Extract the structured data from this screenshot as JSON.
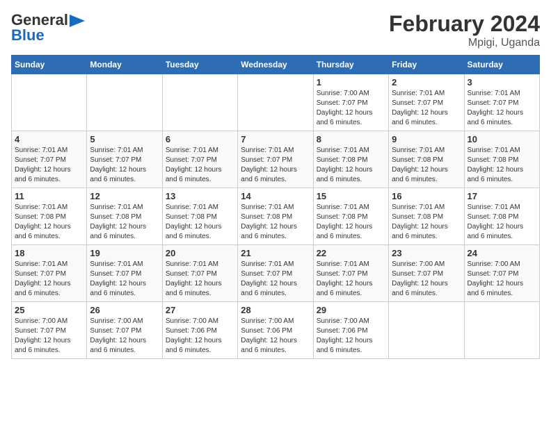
{
  "header": {
    "logo_general": "General",
    "logo_blue": "Blue",
    "main_title": "February 2024",
    "subtitle": "Mpigi, Uganda"
  },
  "days_of_week": [
    "Sunday",
    "Monday",
    "Tuesday",
    "Wednesday",
    "Thursday",
    "Friday",
    "Saturday"
  ],
  "weeks": [
    [
      {
        "day": "",
        "info": ""
      },
      {
        "day": "",
        "info": ""
      },
      {
        "day": "",
        "info": ""
      },
      {
        "day": "",
        "info": ""
      },
      {
        "day": "1",
        "info": "Sunrise: 7:00 AM\nSunset: 7:07 PM\nDaylight: 12 hours\nand 6 minutes."
      },
      {
        "day": "2",
        "info": "Sunrise: 7:01 AM\nSunset: 7:07 PM\nDaylight: 12 hours\nand 6 minutes."
      },
      {
        "day": "3",
        "info": "Sunrise: 7:01 AM\nSunset: 7:07 PM\nDaylight: 12 hours\nand 6 minutes."
      }
    ],
    [
      {
        "day": "4",
        "info": "Sunrise: 7:01 AM\nSunset: 7:07 PM\nDaylight: 12 hours\nand 6 minutes."
      },
      {
        "day": "5",
        "info": "Sunrise: 7:01 AM\nSunset: 7:07 PM\nDaylight: 12 hours\nand 6 minutes."
      },
      {
        "day": "6",
        "info": "Sunrise: 7:01 AM\nSunset: 7:07 PM\nDaylight: 12 hours\nand 6 minutes."
      },
      {
        "day": "7",
        "info": "Sunrise: 7:01 AM\nSunset: 7:07 PM\nDaylight: 12 hours\nand 6 minutes."
      },
      {
        "day": "8",
        "info": "Sunrise: 7:01 AM\nSunset: 7:08 PM\nDaylight: 12 hours\nand 6 minutes."
      },
      {
        "day": "9",
        "info": "Sunrise: 7:01 AM\nSunset: 7:08 PM\nDaylight: 12 hours\nand 6 minutes."
      },
      {
        "day": "10",
        "info": "Sunrise: 7:01 AM\nSunset: 7:08 PM\nDaylight: 12 hours\nand 6 minutes."
      }
    ],
    [
      {
        "day": "11",
        "info": "Sunrise: 7:01 AM\nSunset: 7:08 PM\nDaylight: 12 hours\nand 6 minutes."
      },
      {
        "day": "12",
        "info": "Sunrise: 7:01 AM\nSunset: 7:08 PM\nDaylight: 12 hours\nand 6 minutes."
      },
      {
        "day": "13",
        "info": "Sunrise: 7:01 AM\nSunset: 7:08 PM\nDaylight: 12 hours\nand 6 minutes."
      },
      {
        "day": "14",
        "info": "Sunrise: 7:01 AM\nSunset: 7:08 PM\nDaylight: 12 hours\nand 6 minutes."
      },
      {
        "day": "15",
        "info": "Sunrise: 7:01 AM\nSunset: 7:08 PM\nDaylight: 12 hours\nand 6 minutes."
      },
      {
        "day": "16",
        "info": "Sunrise: 7:01 AM\nSunset: 7:08 PM\nDaylight: 12 hours\nand 6 minutes."
      },
      {
        "day": "17",
        "info": "Sunrise: 7:01 AM\nSunset: 7:08 PM\nDaylight: 12 hours\nand 6 minutes."
      }
    ],
    [
      {
        "day": "18",
        "info": "Sunrise: 7:01 AM\nSunset: 7:07 PM\nDaylight: 12 hours\nand 6 minutes."
      },
      {
        "day": "19",
        "info": "Sunrise: 7:01 AM\nSunset: 7:07 PM\nDaylight: 12 hours\nand 6 minutes."
      },
      {
        "day": "20",
        "info": "Sunrise: 7:01 AM\nSunset: 7:07 PM\nDaylight: 12 hours\nand 6 minutes."
      },
      {
        "day": "21",
        "info": "Sunrise: 7:01 AM\nSunset: 7:07 PM\nDaylight: 12 hours\nand 6 minutes."
      },
      {
        "day": "22",
        "info": "Sunrise: 7:01 AM\nSunset: 7:07 PM\nDaylight: 12 hours\nand 6 minutes."
      },
      {
        "day": "23",
        "info": "Sunrise: 7:00 AM\nSunset: 7:07 PM\nDaylight: 12 hours\nand 6 minutes."
      },
      {
        "day": "24",
        "info": "Sunrise: 7:00 AM\nSunset: 7:07 PM\nDaylight: 12 hours\nand 6 minutes."
      }
    ],
    [
      {
        "day": "25",
        "info": "Sunrise: 7:00 AM\nSunset: 7:07 PM\nDaylight: 12 hours\nand 6 minutes."
      },
      {
        "day": "26",
        "info": "Sunrise: 7:00 AM\nSunset: 7:07 PM\nDaylight: 12 hours\nand 6 minutes."
      },
      {
        "day": "27",
        "info": "Sunrise: 7:00 AM\nSunset: 7:06 PM\nDaylight: 12 hours\nand 6 minutes."
      },
      {
        "day": "28",
        "info": "Sunrise: 7:00 AM\nSunset: 7:06 PM\nDaylight: 12 hours\nand 6 minutes."
      },
      {
        "day": "29",
        "info": "Sunrise: 7:00 AM\nSunset: 7:06 PM\nDaylight: 12 hours\nand 6 minutes."
      },
      {
        "day": "",
        "info": ""
      },
      {
        "day": "",
        "info": ""
      }
    ]
  ]
}
